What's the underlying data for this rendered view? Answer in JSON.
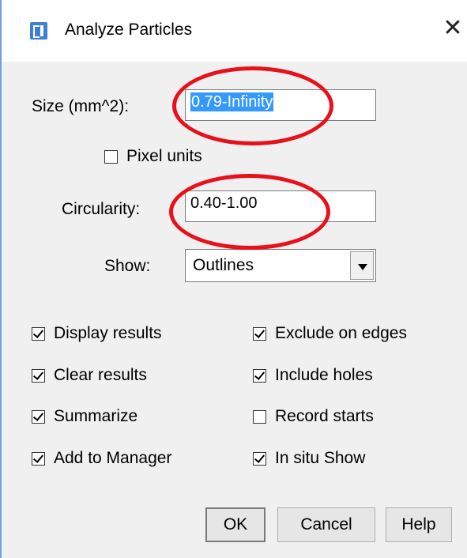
{
  "window": {
    "title": "Analyze Particles",
    "close_glyph": "✕"
  },
  "size": {
    "label": "Size (mm^2):",
    "value": "0.79-Infinity"
  },
  "pixel_units": {
    "label": "Pixel units",
    "checked": false
  },
  "circularity": {
    "label": "Circularity:",
    "value": "0.40-1.00"
  },
  "show": {
    "label": "Show:",
    "value": "Outlines"
  },
  "options_left": [
    {
      "label": "Display results",
      "checked": true
    },
    {
      "label": "Clear results",
      "checked": true
    },
    {
      "label": "Summarize",
      "checked": true
    },
    {
      "label": "Add to Manager",
      "checked": true
    }
  ],
  "options_right": [
    {
      "label": "Exclude on edges",
      "checked": true
    },
    {
      "label": "Include holes",
      "checked": true
    },
    {
      "label": "Record starts",
      "checked": false
    },
    {
      "label": "In situ Show",
      "checked": true
    }
  ],
  "buttons": {
    "ok": "OK",
    "cancel": "Cancel",
    "help": "Help"
  },
  "annotation_color": "#e8101a",
  "icons": {
    "app": "imagej-icon",
    "close": "close-icon",
    "dropdown": "chevron-down-icon"
  }
}
